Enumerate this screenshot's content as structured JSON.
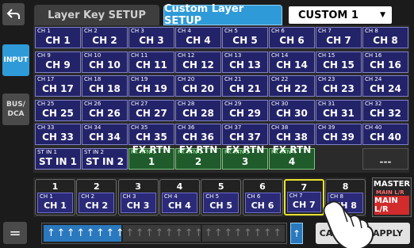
{
  "header": {
    "back_icon": "back-arrow-icon",
    "tabs": [
      {
        "label": "Layer Key SETUP"
      },
      {
        "label": "Custom Layer SETUP"
      }
    ],
    "select": {
      "value": "CUSTOM 1",
      "arrow": "▼"
    }
  },
  "side": {
    "input": "INPUT",
    "bus": "BUS/\nDCA"
  },
  "grid": [
    [
      {
        "s": "CH 1",
        "b": "CH 1"
      },
      {
        "s": "CH 2",
        "b": "CH 2"
      },
      {
        "s": "CH 3",
        "b": "CH 3"
      },
      {
        "s": "CH 4",
        "b": "CH 4"
      },
      {
        "s": "CH 5",
        "b": "CH 5"
      },
      {
        "s": "CH 6",
        "b": "CH 6"
      },
      {
        "s": "CH 7",
        "b": "CH 7"
      },
      {
        "s": "CH 8",
        "b": "CH 8"
      }
    ],
    [
      {
        "s": "CH 9",
        "b": "CH 9"
      },
      {
        "s": "CH 10",
        "b": "CH 10"
      },
      {
        "s": "CH 11",
        "b": "CH 11"
      },
      {
        "s": "CH 12",
        "b": "CH 12"
      },
      {
        "s": "CH 13",
        "b": "CH 13"
      },
      {
        "s": "CH 14",
        "b": "CH 14"
      },
      {
        "s": "CH 15",
        "b": "CH 15"
      },
      {
        "s": "CH 16",
        "b": "CH 16"
      }
    ],
    [
      {
        "s": "CH 17",
        "b": "CH 17"
      },
      {
        "s": "CH 18",
        "b": "CH 18"
      },
      {
        "s": "CH 19",
        "b": "CH 19"
      },
      {
        "s": "CH 20",
        "b": "CH 20"
      },
      {
        "s": "CH 21",
        "b": "CH 21"
      },
      {
        "s": "CH 22",
        "b": "CH 22"
      },
      {
        "s": "CH 23",
        "b": "CH 23"
      },
      {
        "s": "CH 24",
        "b": "CH 24"
      }
    ],
    [
      {
        "s": "CH 25",
        "b": "CH 25"
      },
      {
        "s": "CH 26",
        "b": "CH 26"
      },
      {
        "s": "CH 27",
        "b": "CH 27"
      },
      {
        "s": "CH 28",
        "b": "CH 28"
      },
      {
        "s": "CH 29",
        "b": "CH 29"
      },
      {
        "s": "CH 30",
        "b": "CH 30"
      },
      {
        "s": "CH 31",
        "b": "CH 31"
      },
      {
        "s": "CH 32",
        "b": "CH 32"
      }
    ],
    [
      {
        "s": "CH 33",
        "b": "CH 33"
      },
      {
        "s": "CH 34",
        "b": "CH 34"
      },
      {
        "s": "CH 35",
        "b": "CH 35"
      },
      {
        "s": "CH 36",
        "b": "CH 36"
      },
      {
        "s": "CH 37",
        "b": "CH 37"
      },
      {
        "s": "CH 38",
        "b": "CH 38"
      },
      {
        "s": "CH 39",
        "b": "CH 39"
      },
      {
        "s": "CH 40",
        "b": "CH 40"
      }
    ],
    [
      {
        "s": "ST IN 1",
        "b": "ST IN 1",
        "k": "st"
      },
      {
        "s": "ST IN 2",
        "b": "ST IN 2",
        "k": "st"
      },
      {
        "s": "FX RTN 1",
        "b": "FX RTN 1",
        "k": "fx"
      },
      {
        "s": "FX RTN 2",
        "b": "FX RTN 2",
        "k": "fx"
      },
      {
        "s": "FX RTN 3",
        "b": "FX RTN 3",
        "k": "fx"
      },
      {
        "s": "FX RTN 4",
        "b": "FX RTN 4",
        "k": "fx"
      },
      {
        "s": "",
        "b": "",
        "k": "none"
      },
      {
        "s": "",
        "b": "---",
        "k": "blank"
      }
    ]
  ],
  "strip": [
    {
      "n": "1",
      "s": "CH 1",
      "b": "CH 1"
    },
    {
      "n": "2",
      "s": "CH 2",
      "b": "CH 2"
    },
    {
      "n": "3",
      "s": "CH 3",
      "b": "CH 3"
    },
    {
      "n": "4",
      "s": "CH 4",
      "b": "CH 4"
    },
    {
      "n": "5",
      "s": "CH 5",
      "b": "CH 5"
    },
    {
      "n": "6",
      "s": "CH 6",
      "b": "CH 6"
    },
    {
      "n": "7",
      "s": "CH 7",
      "b": "CH 7",
      "on": true
    },
    {
      "n": "8",
      "s": "CH 8",
      "b": "CH 8"
    }
  ],
  "master": {
    "title": "MASTER",
    "sub": "MAIN L/R",
    "button": "MAIN L/R"
  },
  "bottom": {
    "eq": "=",
    "lone_fader": "↑",
    "cancel": "CANCEL",
    "apply": "APPLY"
  },
  "colors": {
    "accent": "#2f9ad8",
    "highlight": "#e9e22f",
    "master": "#d12b2b",
    "fx": "#1f5b2b"
  }
}
